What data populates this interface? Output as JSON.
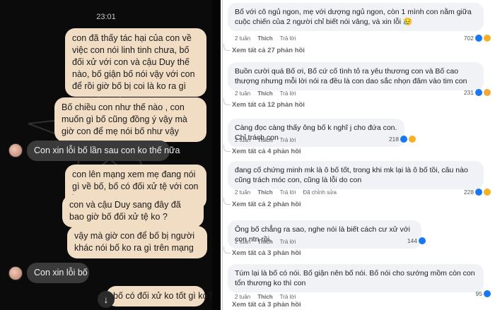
{
  "chat": {
    "time": "23:01",
    "messages": [
      {
        "side": "out",
        "text": "con đã thấy tác hại của con về việc con nói linh tinh chưa, bố đối xử với con và cậu Duy thế nào, bố giận bố nói vậy với con để rồi giờ bố bị coi là ko ra gì"
      },
      {
        "side": "out",
        "text": "Bố chiều con như thế nào , con muốn gì bố cũng đồng ý vậy mà giờ con để mẹ nói bố như vậy"
      },
      {
        "side": "in",
        "text": "Con xin lỗi bố lần sau con ko thế nữa"
      },
      {
        "side": "out",
        "text": "con lên mạng xem mẹ đang nói gì về bố, bố có đối xử tệ với con ko"
      },
      {
        "side": "out",
        "text": "con và cậu Duy sang đây đã bao giờ bố đối xử tệ ko ?"
      },
      {
        "side": "out",
        "text": "vậy mà giờ con để bố bị người khác nói bố ko ra gì trên mạng"
      },
      {
        "side": "in",
        "text": "Con xin lỗi bố"
      },
      {
        "side": "out",
        "text": "bố có đối xử ko tốt gì ko?"
      }
    ],
    "scroll_icon": "arrow-down-icon",
    "scroll_glyph": "↓"
  },
  "comments": {
    "labels": {
      "like": "Thích",
      "reply": "Trả lời",
      "edited": "Đã chỉnh sửa"
    },
    "items": [
      {
        "text": "Bố với cô ngủ ngon, mẹ với dượng ngủ ngon, còn 1 mình con nằm giữa cuộc chiến của 2 người chỉ biết nói vâng, và xin lỗi 😥",
        "time": "2 tuần",
        "reacts": "702",
        "view_more": "Xem tất cả 27 phản hồi",
        "edited": false
      },
      {
        "text": "Buồn cười quá Bố ơi, Bố cứ cố tình tỏ ra yêu thương con và Bố cao thượng nhưng mỗi lời nói ra đều là con dao sắc nhọn đâm vào tim con",
        "time": "2 tuần",
        "reacts": "231",
        "view_more": "Xem tất cả 12 phản hồi",
        "edited": false
      },
      {
        "text": "Càng đọc càng thấy ông bố k nghĩ j cho đứa con. Chỉ trách con",
        "time": "2 tuần",
        "reacts": "218",
        "view_more": "Xem tất cả 4 phản hồi",
        "edited": false
      },
      {
        "text": "đang cố chứng minh mk là ô bố tốt, trong khi mk lại là ô bố tồi, câu nào cũng trách móc con, cũng là lỗi do con",
        "time": "2 tuần",
        "reacts": "228",
        "view_more": "Xem tất cả 2 phản hồi",
        "edited": true
      },
      {
        "text": "Ông bố chẳng ra sao, nghe nói là biết cách cư xử với con ntn rồi.",
        "time": "2 tuần",
        "reacts": "144",
        "view_more": "Xem tất cả 3 phản hồi",
        "edited": false
      },
      {
        "text": "Túm lại là bố có nói. Bố giận nên bố nói. Bố nói cho sướng mồm còn con tổn thương ko thì con",
        "time": "2 tuần",
        "reacts": "95",
        "view_more": "Xem tất cả 3 phản hồi",
        "edited": false
      }
    ]
  },
  "colors": {
    "out_bubble": "#f1dcc4",
    "in_bubble": "#3a3a3a",
    "comment_bg": "#f0f2f5",
    "like_blue": "#1877f2"
  }
}
